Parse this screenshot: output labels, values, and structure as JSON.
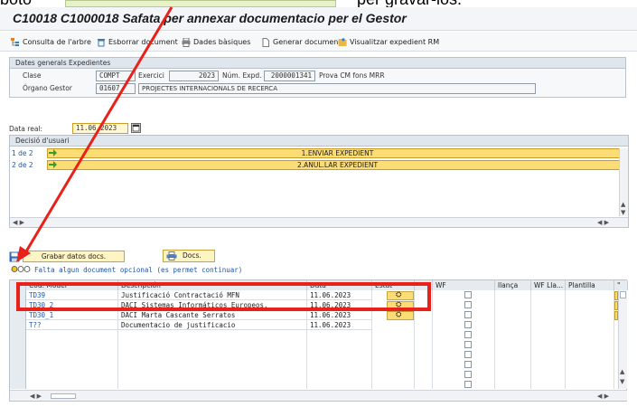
{
  "top_caption": {
    "left": "boto",
    "right": "per gravar-los."
  },
  "window_title": "C10018 C1000018 Safata per annexar documentacio per el Gestor",
  "toolbar": [
    {
      "label": "Consulta de l'arbre",
      "icon": "tree-icon"
    },
    {
      "label": "Esborrar document",
      "icon": "trash-icon"
    },
    {
      "label": "Dades bàsiques",
      "icon": "print-icon"
    },
    {
      "label": "Generar document",
      "icon": "document-icon"
    },
    {
      "label": "Visualitzar expedient RM",
      "icon": "folder-icon"
    }
  ],
  "general": {
    "header": "Dates generals Expedientes",
    "clase_label": "Clase",
    "clase_value": "COMPT",
    "exercici_label": "Exercici",
    "exercici_value": "2023",
    "num_label": "Núm. Expd.",
    "num_value": "2000001341",
    "num_desc": "Prova CM fons MRR",
    "organ_label": "Órgano Gestor",
    "organ_value": "01607",
    "organ_desc": "PROJECTES INTERNACIONALS DE RECERCA"
  },
  "data_real": {
    "label": "Data real:",
    "value": "11.06.2023"
  },
  "decisio": {
    "header": "Decisió d'usuari",
    "rows": [
      {
        "index": "1 de 2",
        "action": "1.ENVIAR EXPEDIENT"
      },
      {
        "index": "2 de 2",
        "action": "2.ANUL.LAR EXPEDIENT"
      }
    ]
  },
  "buttons": {
    "grabar": "Grabar datos docs.",
    "docs": "Docs."
  },
  "status_message": "Falta algun document opcional (es permet continuar)",
  "doc_table": {
    "columns": [
      "Cod. Model",
      "Descripción",
      "Data",
      "Estat",
      "WF",
      "llança",
      "WF Lla...",
      "Plantilla"
    ],
    "rows": [
      {
        "code": "TD39",
        "desc": "Justificació Contractació MFN",
        "date": "11.06.2023"
      },
      {
        "code": "TD30_2",
        "desc": "DACI Sistemas Informáticos Europeos.",
        "date": "11.06.2023"
      },
      {
        "code": "TD30_1",
        "desc": "DACI Marta Cascante Serratos",
        "date": "11.06.2023"
      },
      {
        "code": "T??",
        "desc": "Documentacio de justificacio",
        "date": "11.06.2023"
      }
    ]
  },
  "annotation": {
    "arrow_color": "#e8211a",
    "highlight_color": "#e8211a"
  }
}
